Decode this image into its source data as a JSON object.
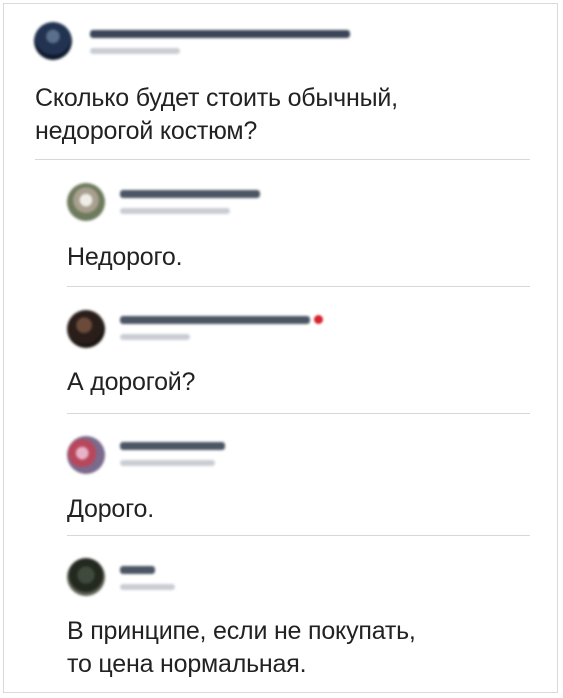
{
  "post": {
    "text": "Сколько будет стоить обычный, недорогой костюм?",
    "text_lines": [
      "Сколько будет стоить обычный,",
      "недорогой костюм?"
    ]
  },
  "replies": [
    {
      "text": "Недорого."
    },
    {
      "text": "А дорогой?"
    },
    {
      "text": "Дорого."
    },
    {
      "text": "В принципе, если не покупать, то цена нормальная.",
      "text_lines": [
        "В принципе, если не покупать,",
        "то цена нормальная."
      ]
    }
  ],
  "colors": {
    "divider": "#d8d8d8",
    "heart": "#d8232a",
    "text": "#222222"
  },
  "icons": {
    "reaction": "heart-icon"
  }
}
